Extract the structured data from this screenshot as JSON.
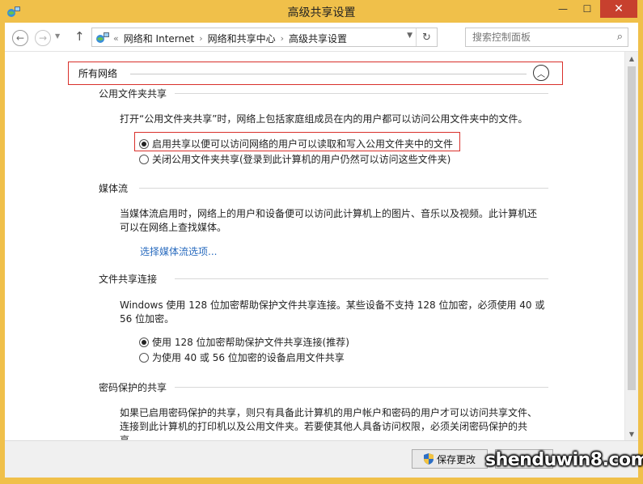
{
  "window": {
    "title": "高级共享设置",
    "minimize_glyph": "—",
    "maximize_glyph": "☐",
    "close_glyph": "✕"
  },
  "navigation": {
    "back_glyph": "←",
    "forward_glyph": "→",
    "recent_glyph": "▼",
    "up_glyph": "↑",
    "breadcrumb_prefix": "«",
    "breadcrumbs": [
      "网络和 Internet",
      "网络和共享中心",
      "高级共享设置"
    ],
    "breadcrumb_separator": "›",
    "dropdown_glyph": "▼",
    "refresh_glyph": "↻",
    "search_placeholder": "搜索控制面板",
    "search_glyph": "⌕"
  },
  "profile": {
    "title": "所有网络",
    "collapse_glyph": "︿",
    "highlight_color": "#d9302b"
  },
  "sections": {
    "public_folder": {
      "heading": "公用文件夹共享",
      "description": "打开“公用文件夹共享”时，网络上包括家庭组成员在内的用户都可以访问公用文件夹中的文件。",
      "options": [
        {
          "label": "启用共享以便可以访问网络的用户可以读取和写入公用文件夹中的文件",
          "selected": true
        },
        {
          "label": "关闭公用文件夹共享(登录到此计算机的用户仍然可以访问这些文件夹)",
          "selected": false
        }
      ]
    },
    "media_streaming": {
      "heading": "媒体流",
      "description": "当媒体流启用时，网络上的用户和设备便可以访问此计算机上的图片、音乐以及视频。此计算机还可以在网络上查找媒体。",
      "link": "选择媒体流选项..."
    },
    "file_sharing": {
      "heading": "文件共享连接",
      "description": "Windows 使用 128 位加密帮助保护文件共享连接。某些设备不支持 128 位加密，必须使用 40 或 56 位加密。",
      "options": [
        {
          "label": "使用 128 位加密帮助保护文件共享连接(推荐)",
          "selected": true
        },
        {
          "label": "为使用 40 或 56 位加密的设备启用文件共享",
          "selected": false
        }
      ]
    },
    "password_protection": {
      "heading": "密码保护的共享",
      "description": "如果已启用密码保护的共享，则只有具备此计算机的用户帐户和密码的用户才可以访问共享文件、连接到此计算机的打印机以及公用文件夹。若要使其他人具备访问权限，必须关闭密码保护的共享。"
    }
  },
  "footer": {
    "save_label": "保存更改",
    "watermark": "shenduwin8.com"
  },
  "scrollbar": {
    "up_glyph": "▲",
    "down_glyph": "▼"
  },
  "colors": {
    "titlebar": "#f0c04a",
    "close_button": "#c7402e",
    "link": "#2a6cbf"
  }
}
